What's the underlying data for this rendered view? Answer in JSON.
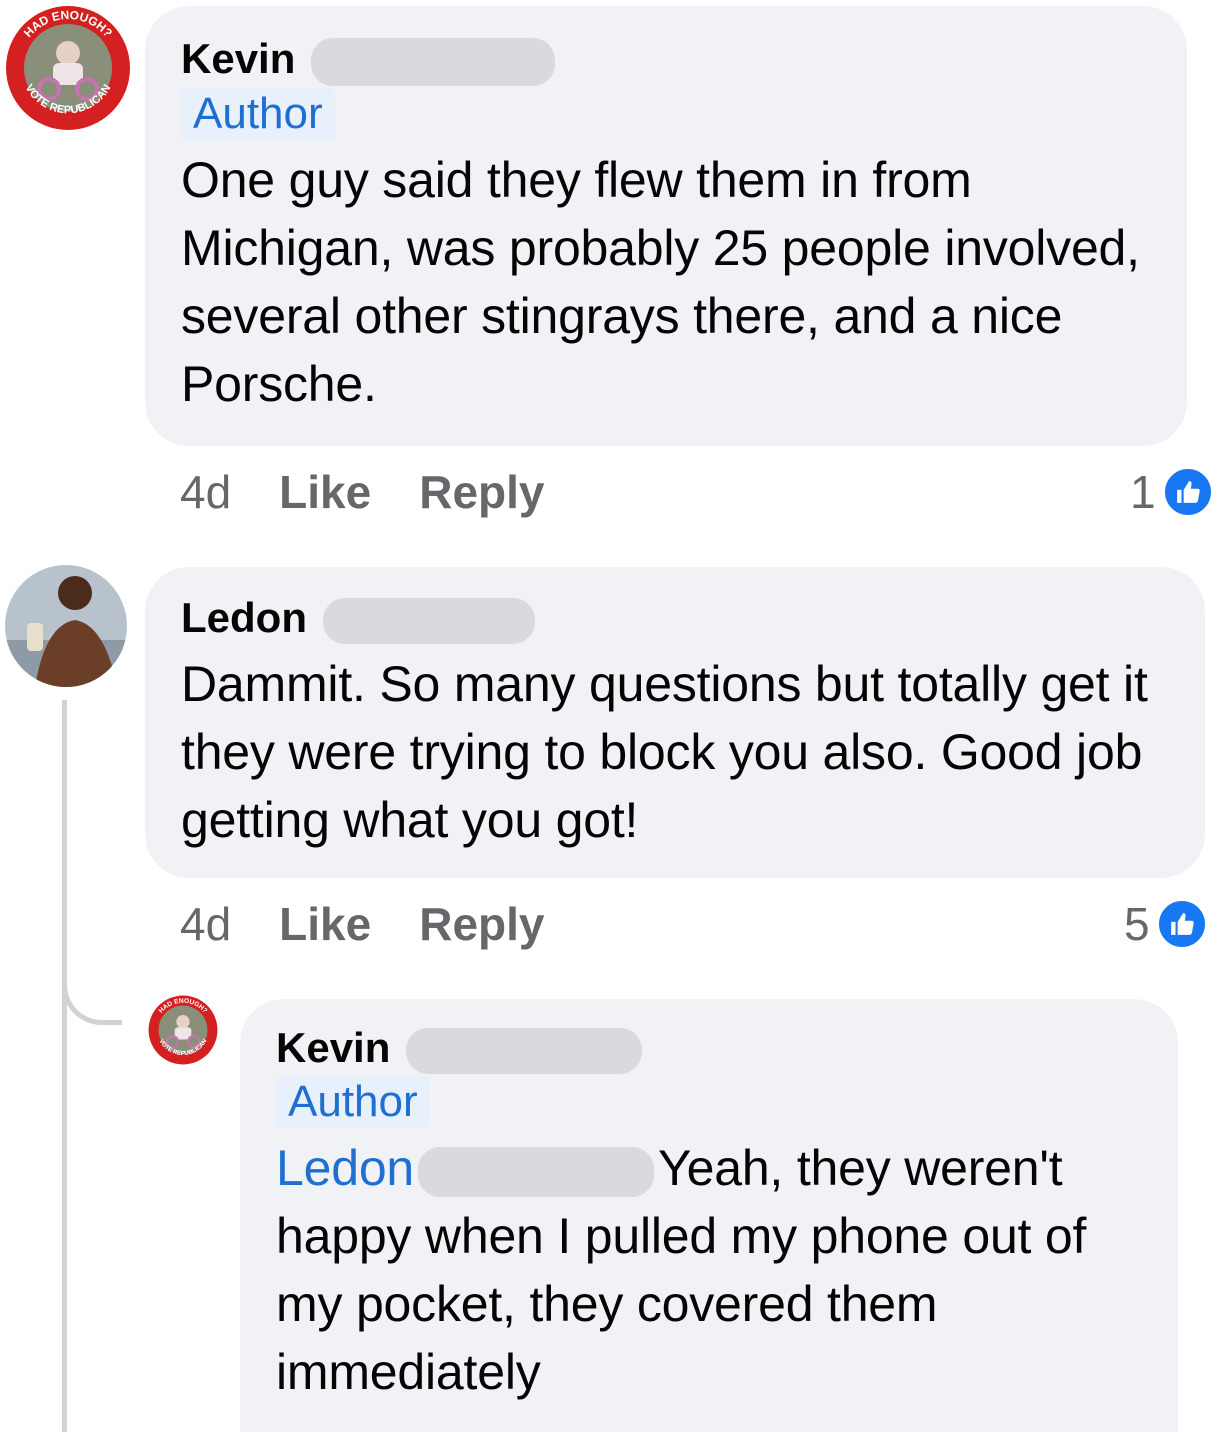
{
  "comments": [
    {
      "author": "Kevin",
      "badge": "Author",
      "text": "One guy said they flew them in from Michigan, was probably 25 people involved, several other stingrays there, and a nice Porsche.",
      "time": "4d",
      "like_label": "Like",
      "reply_label": "Reply",
      "reaction_count": "1",
      "avatar_text_top": "HAD ENOUGH?",
      "avatar_text_bottom": "VOTE REPUBLICAN"
    },
    {
      "author": "Ledon",
      "text": "Dammit.  So many questions but totally get it they were trying to block you also.  Good job getting what you got!",
      "time": "4d",
      "like_label": "Like",
      "reply_label": "Reply",
      "reaction_count": "5"
    },
    {
      "author": "Kevin",
      "badge": "Author",
      "mention": "Ledon",
      "text": "Yeah, they weren't happy when I pulled my phone out of my pocket, they covered them immediately",
      "avatar_text_top": "HAD ENOUGH?",
      "avatar_text_bottom": "VOTE REPUBLICAN"
    }
  ],
  "colors": {
    "bubble": "#f0f2f5",
    "link_blue": "#1f6fd0",
    "like_blue": "#1877f2",
    "meta_gray": "#65676b",
    "badge_red": "#d42020"
  },
  "icons": [
    "like-thumb-icon"
  ]
}
